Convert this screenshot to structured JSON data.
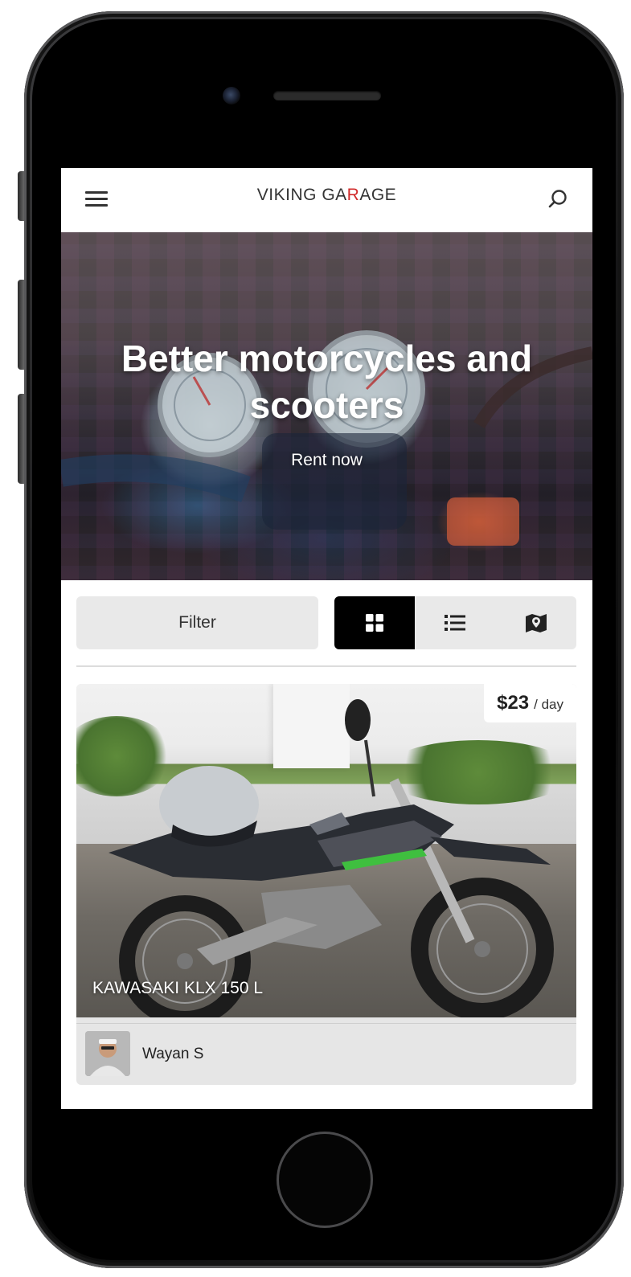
{
  "header": {
    "brand_part1": "VIKING GA",
    "brand_accent": "R",
    "brand_part2": "AGE",
    "accent_color": "#d12b2b"
  },
  "hero": {
    "title": "Better motorcycles and scooters",
    "cta": "Rent now"
  },
  "controls": {
    "filter_label": "Filter",
    "views": [
      {
        "name": "grid",
        "icon": "grid-icon",
        "active": true
      },
      {
        "name": "list",
        "icon": "list-icon",
        "active": false
      },
      {
        "name": "map",
        "icon": "map-icon",
        "active": false
      }
    ]
  },
  "listing": {
    "title": "KAWASAKI KLX 150 L",
    "price": "$23",
    "price_unit": "/ day",
    "owner": {
      "name": "Wayan S",
      "avatar_icon": "avatar"
    }
  }
}
